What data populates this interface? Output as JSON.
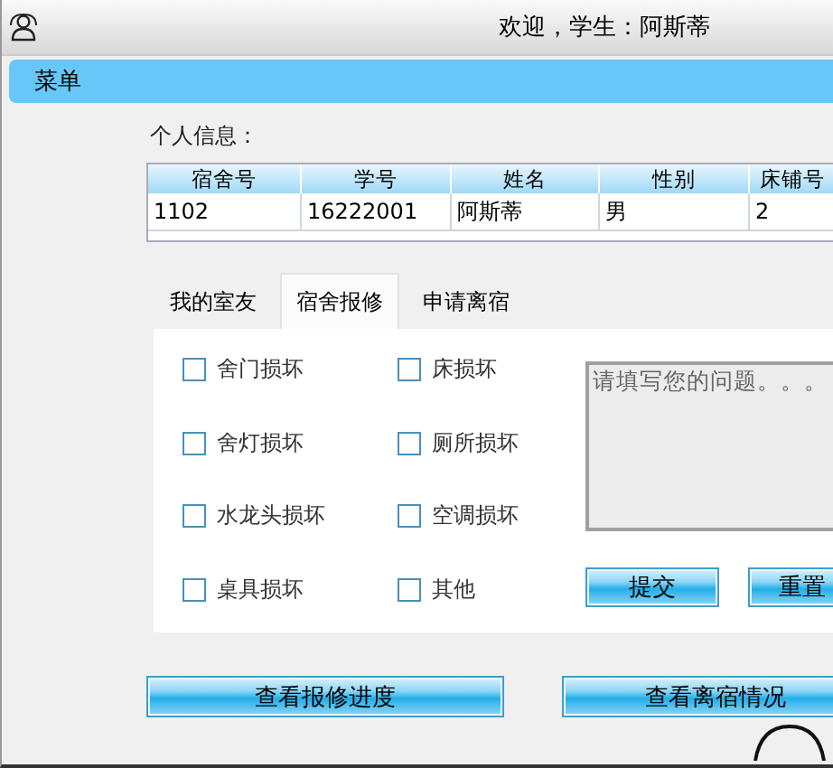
{
  "window": {
    "title": "欢迎，学生：阿斯蒂"
  },
  "menu": {
    "label": "菜单"
  },
  "personal_info": {
    "label": "个人信息：",
    "columns": [
      "宿舍号",
      "学号",
      "姓名",
      "性别",
      "床铺号"
    ],
    "rows": [
      [
        "1102",
        "16222001",
        "阿斯蒂",
        "男",
        "2"
      ]
    ]
  },
  "tabs": [
    {
      "label": "我的室友",
      "selected": false
    },
    {
      "label": "宿舍报修",
      "selected": true
    },
    {
      "label": "申请离宿",
      "selected": false
    }
  ],
  "repair": {
    "options": [
      {
        "label": "舍门损坏",
        "checked": false
      },
      {
        "label": "床损坏",
        "checked": false
      },
      {
        "label": "舍灯损坏",
        "checked": false
      },
      {
        "label": "厕所损坏",
        "checked": false
      },
      {
        "label": "水龙头损坏",
        "checked": false
      },
      {
        "label": "空调损坏",
        "checked": false
      },
      {
        "label": "桌具损坏",
        "checked": false
      },
      {
        "label": "其他",
        "checked": false
      }
    ],
    "problem": {
      "placeholder": "请填写您的问题。。。"
    },
    "buttons": [
      "提交",
      "重置"
    ]
  },
  "bottom_buttons": [
    "查看报修进度",
    "查看离宿情况"
  ]
}
